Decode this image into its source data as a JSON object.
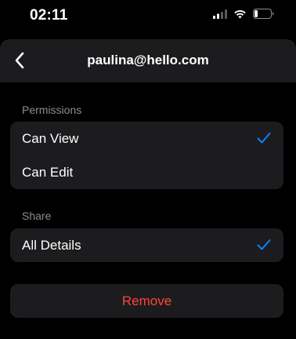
{
  "status_bar": {
    "time": "02:11"
  },
  "header": {
    "title": "paulina@hello.com",
    "back_icon": "chevron-left-icon"
  },
  "permissions": {
    "label": "Permissions",
    "options": [
      {
        "label": "Can View",
        "selected": true
      },
      {
        "label": "Can Edit",
        "selected": false
      }
    ]
  },
  "share": {
    "label": "Share",
    "options": [
      {
        "label": "All Details",
        "selected": true
      }
    ]
  },
  "actions": {
    "remove_label": "Remove"
  },
  "colors": {
    "accent": "#0a84ff",
    "destructive": "#ff453a",
    "group_bg": "#1c1c1e"
  }
}
